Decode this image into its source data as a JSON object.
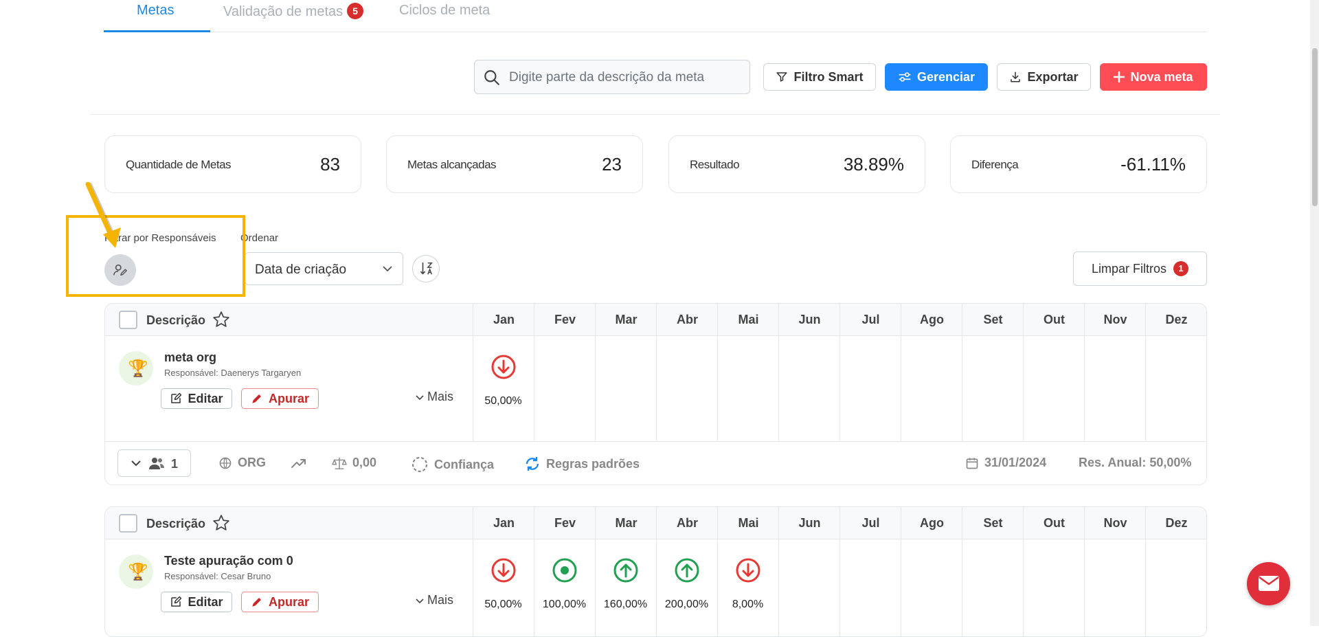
{
  "tabs": [
    {
      "label": "Metas",
      "active": true
    },
    {
      "label": "Validação de metas",
      "badge": "5"
    },
    {
      "label": "Ciclos de meta"
    }
  ],
  "toolbar": {
    "search_placeholder": "Digite parte da descrição da meta",
    "smart_filter_label": "Filtro Smart",
    "manage_label": "Gerenciar",
    "export_label": "Exportar",
    "new_goal_label": "Nova meta"
  },
  "stats": [
    {
      "label": "Quantidade de Metas",
      "value": "83"
    },
    {
      "label": "Metas alcançadas",
      "value": "23"
    },
    {
      "label": "Resultado",
      "value": "38.89%"
    },
    {
      "label": "Diferença",
      "value": "-61.11%"
    }
  ],
  "filters": {
    "responsible_label": "Filtrar por Responsáveis",
    "order_label": "Ordenar",
    "order_value": "Data de criação",
    "clear_label": "Limpar Filtros",
    "clear_badge": "1"
  },
  "table": {
    "description_header": "Descrição",
    "months": [
      "Jan",
      "Fev",
      "Mar",
      "Abr",
      "Mai",
      "Jun",
      "Jul",
      "Ago",
      "Set",
      "Out",
      "Nov",
      "Dez"
    ]
  },
  "goals": [
    {
      "name": "meta org",
      "responsible": "Responsável: Daenerys Targaryen",
      "edit_label": "Editar",
      "apurar_label": "Apurar",
      "more_label": "Mais",
      "results": [
        {
          "month": "Jan",
          "value": "50,00%",
          "status": "down"
        }
      ],
      "footer": {
        "participants": "1",
        "scope": "ORG",
        "weight": "0,00",
        "confidence_label": "Confiança",
        "rules_label": "Regras padrões",
        "date": "31/01/2024",
        "annual": "Res. Anual: 50,00%"
      }
    },
    {
      "name": "Teste apuração com 0",
      "responsible": "Responsável: Cesar Bruno",
      "edit_label": "Editar",
      "apurar_label": "Apurar",
      "more_label": "Mais",
      "results": [
        {
          "month": "Jan",
          "value": "50,00%",
          "status": "down"
        },
        {
          "month": "Fev",
          "value": "100,00%",
          "status": "target"
        },
        {
          "month": "Mar",
          "value": "160,00%",
          "status": "up"
        },
        {
          "month": "Abr",
          "value": "200,00%",
          "status": "up"
        },
        {
          "month": "Mai",
          "value": "8,00%",
          "status": "down"
        }
      ]
    }
  ],
  "colors": {
    "accent": "#1e88ff",
    "danger": "#ff4d55",
    "success": "#22a052",
    "highlight": "#f4b400"
  }
}
